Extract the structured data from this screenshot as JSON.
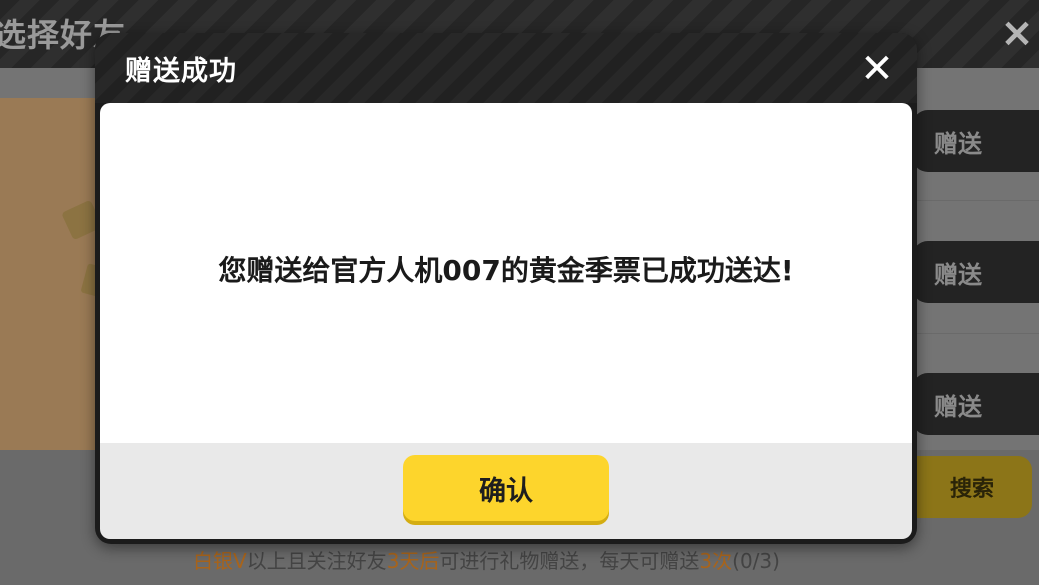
{
  "background": {
    "title": "选择好友",
    "close_icon": "×",
    "gift_buttons": [
      "赠送",
      "赠送",
      "赠送"
    ],
    "search_label": "搜索",
    "notice": {
      "part1": "白银V",
      "part2": "以上且关注好友",
      "part3": "3天后",
      "part4": "可进行礼物赠送，每天可赠送",
      "part5": "3次",
      "part6": "(0/3)"
    }
  },
  "modal": {
    "title": "赠送成功",
    "close_icon": "✕",
    "message": "您赠送给官方人机007的黄金季票已成功送达!",
    "confirm_label": "确认"
  },
  "colors": {
    "accent_yellow": "#fdd52c",
    "header_dark": "#212121",
    "highlight": "#a8641b"
  }
}
